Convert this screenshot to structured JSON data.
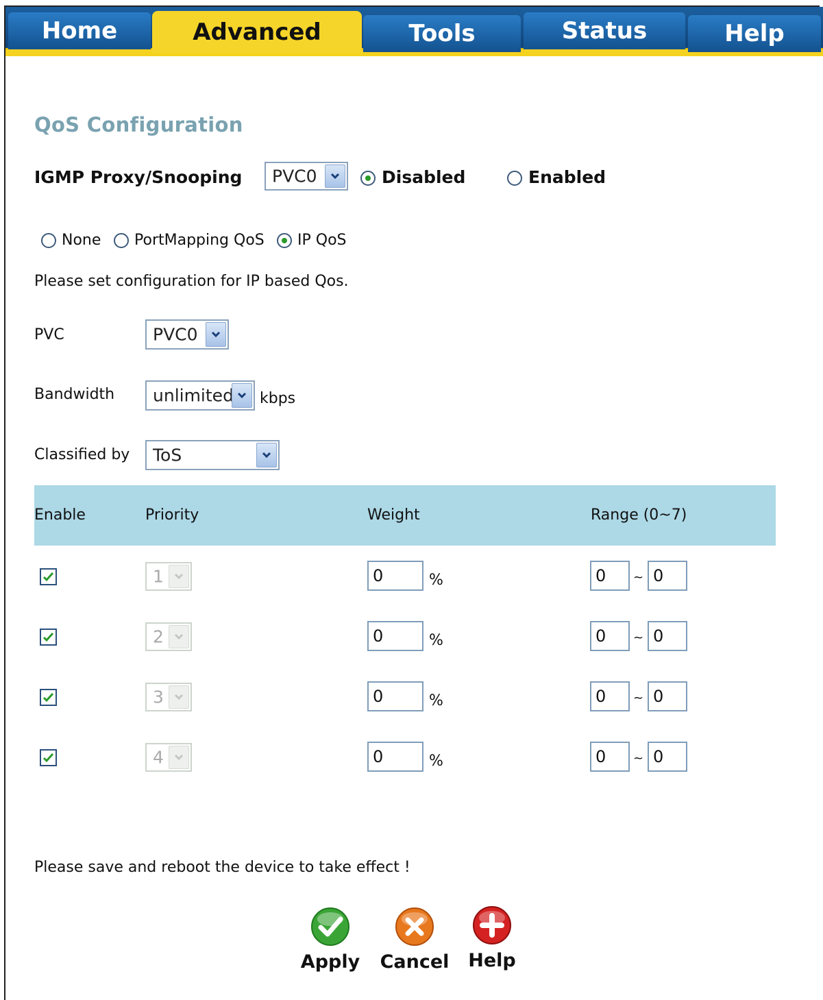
{
  "nav": {
    "tabs": [
      {
        "label": "Home"
      },
      {
        "label": "Advanced"
      },
      {
        "label": "Tools"
      },
      {
        "label": "Status"
      },
      {
        "label": "Help"
      }
    ]
  },
  "page": {
    "title": "QoS Configuration"
  },
  "igmp": {
    "label": "IGMP Proxy/Snooping",
    "pvc_value": "PVC0",
    "disabled_label": "Disabled",
    "enabled_label": "Enabled",
    "selected": "Disabled"
  },
  "qos_mode": {
    "options": [
      "None",
      "PortMapping QoS",
      "IP QoS"
    ],
    "selected": "IP QoS"
  },
  "instruction": "Please set configuration for IP based Qos.",
  "form": {
    "pvc_label": "PVC",
    "pvc_value": "PVC0",
    "bandwidth_label": "Bandwidth",
    "bandwidth_value": "unlimited",
    "bandwidth_unit": "kbps",
    "classified_label": "Classified by",
    "classified_value": "ToS"
  },
  "table": {
    "headers": {
      "enable": "Enable",
      "priority": "Priority",
      "weight": "Weight",
      "range": "Range (0~7)"
    },
    "rows": [
      {
        "enabled": true,
        "priority": "1",
        "weight": "0",
        "weight_unit": "%",
        "range_from": "0",
        "range_sep": "~",
        "range_to": "0"
      },
      {
        "enabled": true,
        "priority": "2",
        "weight": "0",
        "weight_unit": "%",
        "range_from": "0",
        "range_sep": "~",
        "range_to": "0"
      },
      {
        "enabled": true,
        "priority": "3",
        "weight": "0",
        "weight_unit": "%",
        "range_from": "0",
        "range_sep": "~",
        "range_to": "0"
      },
      {
        "enabled": true,
        "priority": "4",
        "weight": "0",
        "weight_unit": "%",
        "range_from": "0",
        "range_sep": "~",
        "range_to": "0"
      }
    ]
  },
  "notice": "Please save and reboot the device to take effect !",
  "actions": {
    "apply": "Apply",
    "cancel": "Cancel",
    "help": "Help"
  },
  "colors": {
    "nav_blue": "#13528f",
    "nav_yellow": "#f6d52a",
    "title": "#7aa2b0",
    "table_header": "#add8e6",
    "apply_green": "#3aa536",
    "cancel_orange": "#e8781e",
    "help_red": "#d42222"
  }
}
